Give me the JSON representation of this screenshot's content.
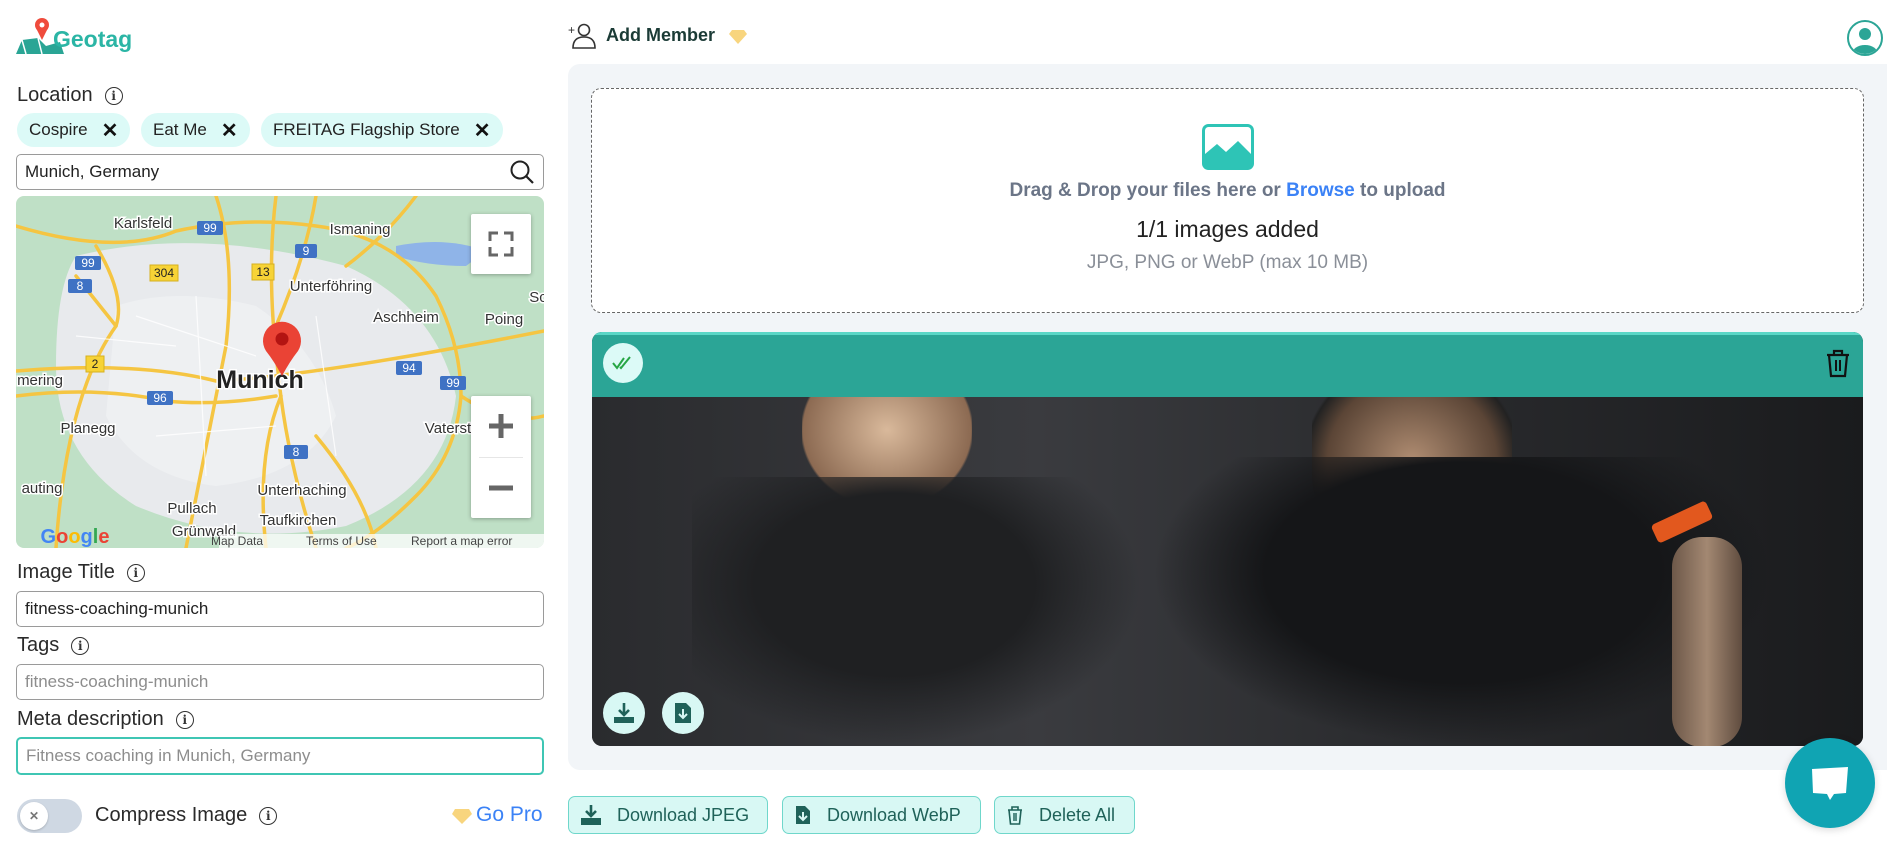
{
  "app": {
    "logo_text": "Geotag"
  },
  "header": {
    "add_member_label": "Add Member"
  },
  "sidebar": {
    "location_label": "Location",
    "location_chips": [
      {
        "label": "Cospire"
      },
      {
        "label": "Eat Me"
      },
      {
        "label": "FREITAG Flagship Store"
      }
    ],
    "location_search_value": "Munich, Germany",
    "map": {
      "city_label": "Munich",
      "place_labels": [
        "Karlsfeld",
        "Ismaning",
        "Unterföhring",
        "Aschheim",
        "Poing",
        "Sc",
        "mering",
        "Planegg",
        "Vaterst",
        "auting",
        "Pullach",
        "Grünwald",
        "Unterhaching",
        "Taufkirchen"
      ],
      "road_shields": [
        "99",
        "99",
        "8",
        "304",
        "13",
        "9",
        "2",
        "96",
        "94",
        "99",
        "8"
      ],
      "footer": {
        "map_data": "Map Data",
        "terms": "Terms of Use",
        "report": "Report a map error"
      },
      "logo_text": "Google"
    },
    "image_title_label": "Image Title",
    "image_title_value": "fitness-coaching-munich",
    "tags_label": "Tags",
    "tags_placeholder": "fitness-coaching-munich",
    "meta_label": "Meta description",
    "meta_placeholder": "Fitness coaching in Munich, Germany",
    "compress_label": "Compress Image",
    "compress_enabled": false,
    "go_pro_label": "Go Pro"
  },
  "upload": {
    "drag_text": "Drag & Drop your files here or",
    "browse_label": "Browse",
    "upload_suffix": "to upload",
    "count_text": "1/1 images added",
    "formats_text": "JPG, PNG or WebP (max 10 MB)"
  },
  "actions": {
    "download_jpeg": "Download JPEG",
    "download_webp": "Download WebP",
    "delete_all": "Delete All"
  },
  "colors": {
    "accent": "#2ba596",
    "chip_bg": "#dcfaf7",
    "link": "#3b82f6",
    "chat": "#10a4b3",
    "premium": "#f8d57e"
  }
}
